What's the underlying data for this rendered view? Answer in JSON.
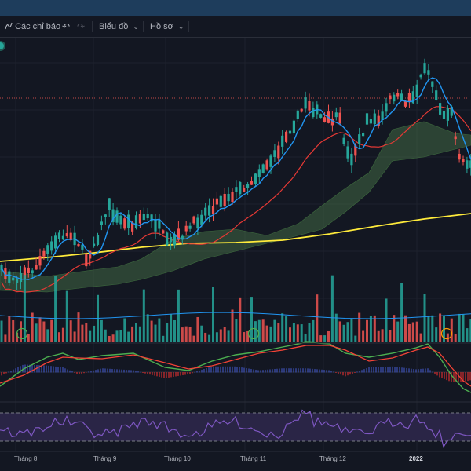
{
  "toolbar": {
    "indicators_label": "Các chỉ báo",
    "undo_icon": "undo-icon",
    "redo_icon": "redo-icon",
    "chart_label": "Biểu đồ",
    "layout_label": "Hồ sơ"
  },
  "colors": {
    "background": "#131722",
    "topbar": "#1e3d5c",
    "up": "#26a69a",
    "down": "#ef5350",
    "ma_fast": "#2196f3",
    "ma_slow": "#e53935",
    "ma_long": "#ffeb3b",
    "cloud": "#4c7a4c",
    "macd": "#4caf50",
    "signal": "#f44336",
    "rsi": "#7e57c2"
  },
  "chart_data": {
    "type": "line",
    "x_ticks": [
      "Tháng 8",
      "Tháng 9",
      "Tháng 10",
      "Tháng 11",
      "Tháng 12",
      "2022"
    ],
    "x_ticks_bold": [
      "2022"
    ],
    "panes": [
      "price",
      "volume",
      "macd",
      "rsi"
    ]
  }
}
